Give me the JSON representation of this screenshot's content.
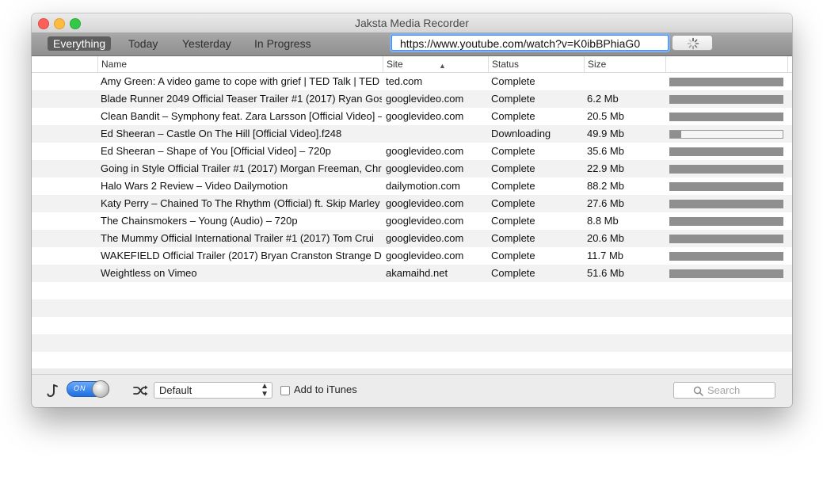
{
  "window": {
    "title": "Jaksta Media Recorder"
  },
  "tabs": [
    {
      "label": "Everything",
      "active": true
    },
    {
      "label": "Today",
      "active": false
    },
    {
      "label": "Yesterday",
      "active": false
    },
    {
      "label": "In Progress",
      "active": false
    }
  ],
  "url_field": {
    "value": "https://www.youtube.com/watch?v=K0ibBPhiaG0"
  },
  "table": {
    "columns": {
      "name": "Name",
      "site": "Site",
      "status": "Status",
      "size": "Size"
    },
    "rows": [
      {
        "name": "Amy Green: A video game to cope with grief | TED Talk | TED",
        "site": "ted.com",
        "status": "Complete",
        "size": "",
        "progress": 1.0
      },
      {
        "name": "Blade Runner 2049 Official Teaser Trailer #1 (2017) Ryan Gos",
        "site": "googlevideo.com",
        "status": "Complete",
        "size": "6.2 Mb",
        "progress": 1.0
      },
      {
        "name": "Clean Bandit – Symphony feat. Zara Larsson [Official Video] –",
        "site": "googlevideo.com",
        "status": "Complete",
        "size": "20.5 Mb",
        "progress": 1.0
      },
      {
        "name": "Ed Sheeran – Castle On The Hill [Official Video].f248",
        "site": "",
        "status": "Downloading",
        "size": "49.9 Mb",
        "progress": 0.1
      },
      {
        "name": "Ed Sheeran – Shape of You [Official Video] – 720p",
        "site": "googlevideo.com",
        "status": "Complete",
        "size": "35.6 Mb",
        "progress": 1.0
      },
      {
        "name": "Going in Style Official Trailer #1 (2017) Morgan Freeman, Chr",
        "site": "googlevideo.com",
        "status": "Complete",
        "size": "22.9 Mb",
        "progress": 1.0
      },
      {
        "name": "Halo Wars 2 Review – Video Dailymotion",
        "site": "dailymotion.com",
        "status": "Complete",
        "size": "88.2 Mb",
        "progress": 1.0
      },
      {
        "name": "Katy Perry – Chained To The Rhythm (Official) ft. Skip Marley",
        "site": "googlevideo.com",
        "status": "Complete",
        "size": "27.6 Mb",
        "progress": 1.0
      },
      {
        "name": "The Chainsmokers – Young (Audio) – 720p",
        "site": "googlevideo.com",
        "status": "Complete",
        "size": "8.8 Mb",
        "progress": 1.0
      },
      {
        "name": "The Mummy Official International Trailer #1 (2017) Tom Crui",
        "site": "googlevideo.com",
        "status": "Complete",
        "size": "20.6 Mb",
        "progress": 1.0
      },
      {
        "name": "WAKEFIELD Official Trailer (2017) Bryan Cranston Strange Dra",
        "site": "googlevideo.com",
        "status": "Complete",
        "size": "11.7 Mb",
        "progress": 1.0
      },
      {
        "name": "Weightless on Vimeo",
        "site": "akamaihd.net",
        "status": "Complete",
        "size": "51.6 Mb",
        "progress": 1.0
      }
    ]
  },
  "bottom": {
    "toggle_label": "ON",
    "profile_select": "Default",
    "add_itunes_label": "Add to iTunes",
    "add_itunes_checked": false,
    "search_placeholder": "Search",
    "icons": {
      "wizard": "music-wand-icon",
      "shuffle": "shuffle-icon",
      "search": "search-icon"
    }
  },
  "colors": {
    "accent": "#4d8ef0",
    "toggle": "#1e6fe0",
    "progress": "#8f8f8f"
  }
}
